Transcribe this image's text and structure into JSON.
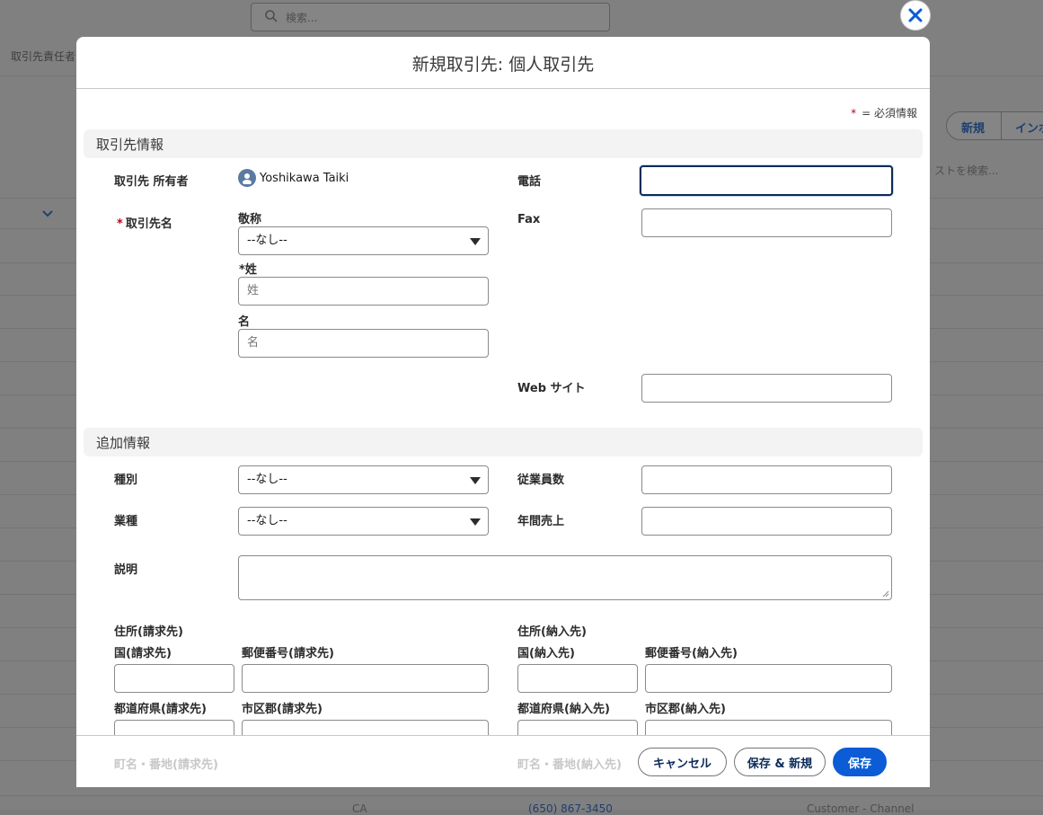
{
  "background": {
    "search_placeholder": "検索...",
    "breadcrumb": "取引先責任者",
    "new_button": "新規",
    "import_button": "インポ",
    "list_search_placeholder": "ストを検索...",
    "footer_fragment_1": "CA",
    "footer_fragment_2": "(650) 867-3450",
    "footer_fragment_3": "Customer - Channel"
  },
  "modal": {
    "title": "新規取引先: 個人取引先",
    "required_star": "*",
    "required_note": "= 必須情報"
  },
  "section_account_info": {
    "title": "取引先情報",
    "owner_label": "取引先 所有者",
    "owner_name": "Yoshikawa Taiki",
    "name_label": "取引先名",
    "salutation_label": "敬称",
    "salutation_value": "--なし--",
    "last_name_label": "姓",
    "last_name_placeholder": "姓",
    "first_name_label": "名",
    "first_name_placeholder": "名",
    "phone_label": "電話",
    "fax_label": "Fax",
    "website_label": "Web サイト"
  },
  "section_additional": {
    "title": "追加情報",
    "type_label": "種別",
    "type_value": "--なし--",
    "industry_label": "業種",
    "industry_value": "--なし--",
    "employees_label": "従業員数",
    "revenue_label": "年間売上",
    "description_label": "説明",
    "billing_heading": "住所(請求先)",
    "billing_country": "国(請求先)",
    "billing_zip": "郵便番号(請求先)",
    "billing_state": "都道府県(請求先)",
    "billing_city": "市区郡(請求先)",
    "billing_street": "町名・番地(請求先)",
    "shipping_heading": "住所(納入先)",
    "shipping_country": "国(納入先)",
    "shipping_zip": "郵便番号(納入先)",
    "shipping_state": "都道府県(納入先)",
    "shipping_city": "市区郡(納入先)",
    "shipping_street": "町名・番地(納入先)"
  },
  "footer": {
    "cancel_label": "キャンセル",
    "save_new_label": "保存 & 新規",
    "save_label": "保存"
  },
  "colors": {
    "brand": "#0b5cd5",
    "required": "#ba0517",
    "focus_border": "#0b2b57"
  },
  "icons": [
    "search-icon",
    "close-icon",
    "chevron-down-icon",
    "avatar-icon",
    "caret-down-icon",
    "resize-grip-icon"
  ]
}
